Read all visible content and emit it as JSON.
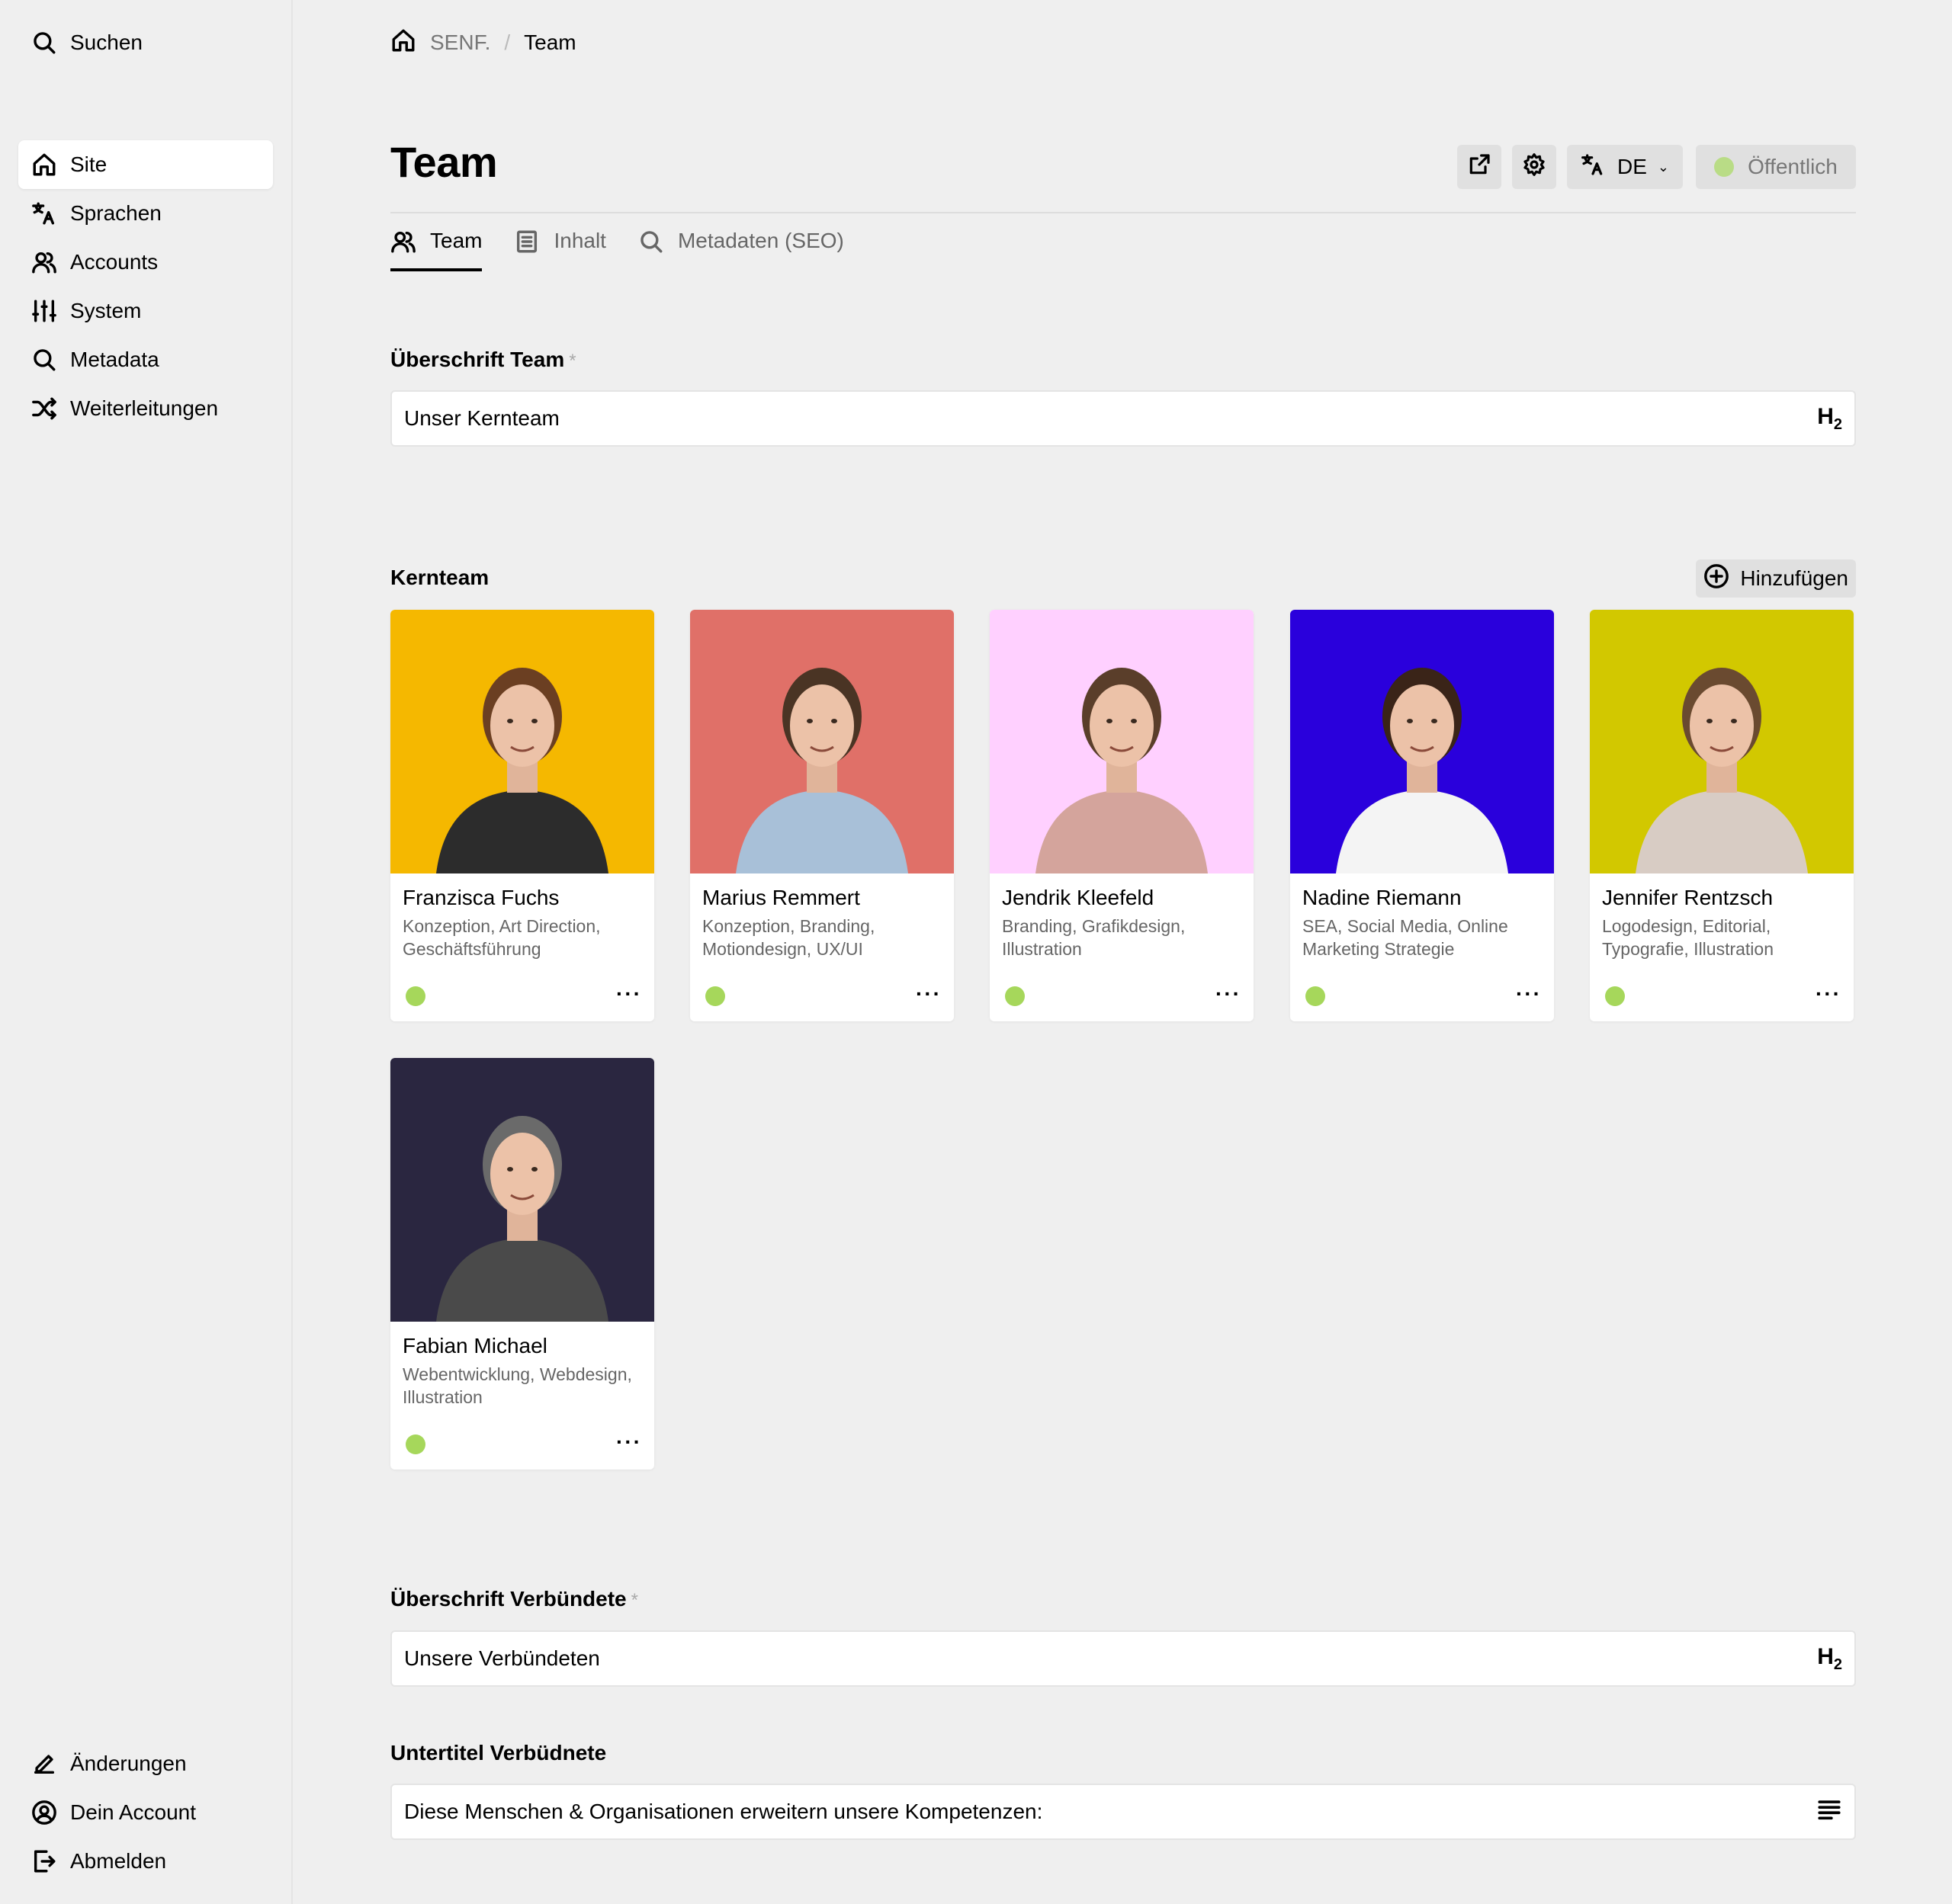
{
  "colors": {
    "status_green": "#a6d75b",
    "sidebar_bg": "#efefef",
    "main_bg": "#efefef"
  },
  "sidebar": {
    "search": {
      "label": "Suchen",
      "icon": "search-icon"
    },
    "items": [
      {
        "label": "Site",
        "icon": "home-icon",
        "active": true
      },
      {
        "label": "Sprachen",
        "icon": "translate-icon"
      },
      {
        "label": "Accounts",
        "icon": "users-icon"
      },
      {
        "label": "System",
        "icon": "sliders-icon"
      },
      {
        "label": "Metadata",
        "icon": "search-icon"
      },
      {
        "label": "Weiterleitungen",
        "icon": "shuffle-icon"
      }
    ],
    "bottom": [
      {
        "label": "Änderungen",
        "icon": "pencil-icon"
      },
      {
        "label": "Dein Account",
        "icon": "user-circle-icon"
      },
      {
        "label": "Abmelden",
        "icon": "logout-icon"
      }
    ]
  },
  "breadcrumb": {
    "root": "SENF.",
    "sep": "/",
    "current": "Team"
  },
  "header": {
    "title": "Team",
    "language": "DE",
    "status_label": "Öffentlich"
  },
  "tabs": [
    {
      "label": "Team",
      "icon": "users-icon",
      "active": true
    },
    {
      "label": "Inhalt",
      "icon": "document-icon"
    },
    {
      "label": "Metadaten (SEO)",
      "icon": "search-icon"
    }
  ],
  "fields": {
    "heading_team": {
      "label": "Überschrift Team",
      "required_mark": "*",
      "value": "Unser Kernteam",
      "suffix": "H"
    },
    "core_team": {
      "label": "Kernteam",
      "add_label": "Hinzufügen"
    },
    "heading_allies": {
      "label": "Überschrift Verbündete",
      "required_mark": "*",
      "value": "Unsere Verbündeten",
      "suffix": "H"
    },
    "subtitle_allies": {
      "label": "Untertitel Verbüdnete",
      "value": "Diese Menschen & Organisationen erweitern unsere Kompetenzen:"
    }
  },
  "team": [
    {
      "name": "Franzisca Fuchs",
      "roles": "Konzeption, Art Direction, Geschäftsführung",
      "bg": "#f5b800",
      "shirt": "#2c2c2c",
      "hair": "#6b3f22"
    },
    {
      "name": "Marius Remmert",
      "roles": "Konzeption, Branding, Motiondesign, UX/UI",
      "bg": "#e07068",
      "shirt": "#a8c0d8",
      "hair": "#4a3424"
    },
    {
      "name": "Jendrik Kleefeld",
      "roles": "Branding, Grafikdesign, Illustration",
      "bg": "#ffd0ff",
      "shirt": "#d4a49c",
      "hair": "#5a3e2a"
    },
    {
      "name": "Nadine Riemann",
      "roles": "SEA, Social Media, Online Marketing Strategie",
      "bg": "#2a00dc",
      "shirt": "#f4f4f4",
      "hair": "#3a2418"
    },
    {
      "name": "Jennifer Rentzsch",
      "roles": "Logodesign, Editorial, Typografie, Illustration",
      "bg": "#d2c800",
      "shirt": "#d8ccc4",
      "hair": "#6a4a30"
    },
    {
      "name": "Fabian Michael",
      "roles": "Webentwicklung, Webdesign, Illustration",
      "bg": "#2a2640",
      "shirt": "#4a4a4a",
      "hair": "#6a6a6a"
    }
  ],
  "card_more_label": "···"
}
